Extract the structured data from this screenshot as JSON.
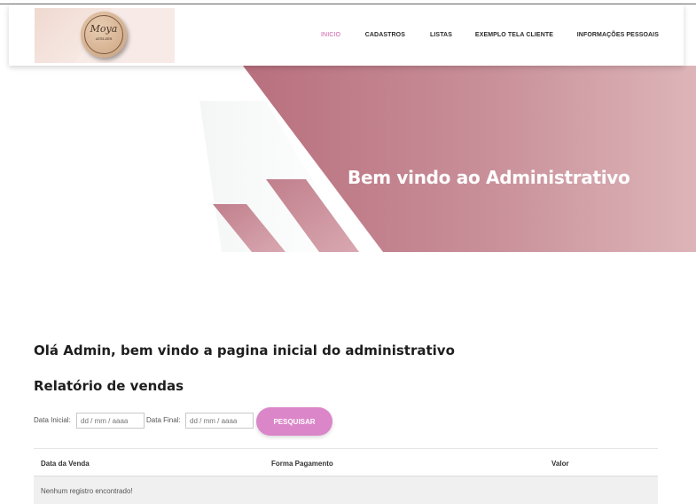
{
  "navbar": {
    "logo_text": "Moya",
    "logo_subtext": "ATELIER",
    "links": [
      {
        "label": "INICIO",
        "active": true
      },
      {
        "label": "CADASTROS",
        "active": false
      },
      {
        "label": "LISTAS",
        "active": false
      },
      {
        "label": "EXEMPLO TELA CLIENTE",
        "active": false
      },
      {
        "label": "INFORMAÇÕES PESSOAIS",
        "active": false
      }
    ]
  },
  "hero": {
    "title": "Bem vindo ao Administrativo"
  },
  "main": {
    "greeting": "Olá Admin, bem vindo a pagina inicial do administrativo",
    "report_title": "Relatório de vendas",
    "filters": {
      "start_label": "Data Inicial:",
      "start_placeholder": "dd / mm / aaaa",
      "end_label": "Data Final:",
      "end_placeholder": "dd / mm / aaaa",
      "search_label": "PESQUISAR"
    },
    "table": {
      "columns": [
        "Data da Venda",
        "Forma Pagamento",
        "Valor"
      ],
      "empty_message": "Nenhum registro encontrado!"
    }
  },
  "colors": {
    "accent": "#cf5da6",
    "button": "#db86c9",
    "hero_band": "#c5848f"
  }
}
